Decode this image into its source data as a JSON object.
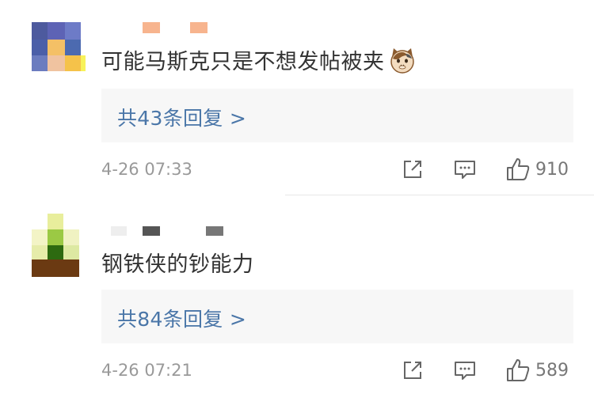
{
  "comments": [
    {
      "text": "可能马斯克只是不想发帖被夹",
      "emoji": "cat-face-emoji",
      "reply_label": "共43条回复 >",
      "timestamp": "4-26 07:33",
      "like_count": "910"
    },
    {
      "text": "钢铁侠的钞能力",
      "reply_label": "共84条回复 >",
      "timestamp": "4-26 07:21",
      "like_count": "589"
    }
  ],
  "icons": {
    "share": "share-icon",
    "reply": "comment-icon",
    "like": "thumbs-up-icon"
  },
  "colors": {
    "link": "#4a76a8",
    "meta": "#999999",
    "reply_bg": "#f7f7f7"
  }
}
